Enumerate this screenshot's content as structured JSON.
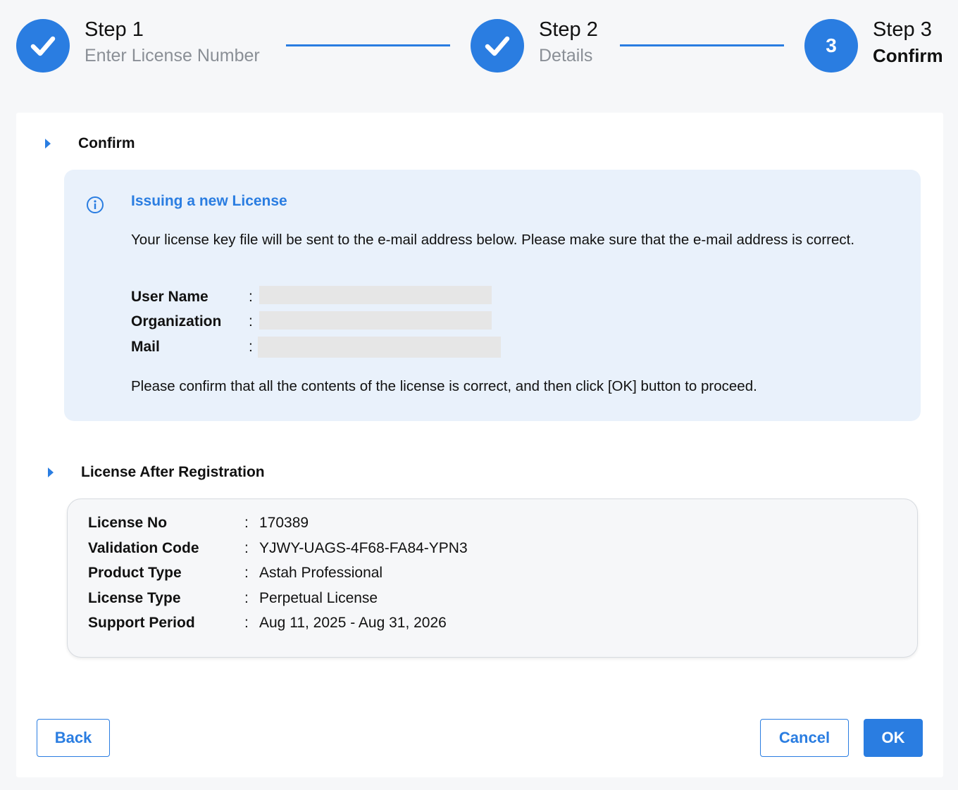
{
  "steps": [
    {
      "title": "Step 1",
      "subtitle": "Enter License Number",
      "status": "done",
      "icon": "check-icon"
    },
    {
      "title": "Step 2",
      "subtitle": "Details",
      "status": "done",
      "icon": "check-icon"
    },
    {
      "title": "Step 3",
      "subtitle": "Confirm",
      "status": "active",
      "number": "3"
    }
  ],
  "confirm_section": {
    "title": "Confirm",
    "info": {
      "icon": "info-icon",
      "title": "Issuing a new License",
      "text": "Your license key file will be sent to the e-mail address below. Please make sure that the e-mail address is correct.",
      "fields": [
        {
          "label": "User Name",
          "colon": ":"
        },
        {
          "label": "Organization",
          "colon": ":"
        },
        {
          "label": "Mail",
          "colon": ":"
        }
      ],
      "confirm_text": "Please confirm that all the contents of the license is correct, and then click [OK] button to proceed."
    }
  },
  "license_section": {
    "title": "License After Registration",
    "rows": [
      {
        "label": "License No",
        "colon": ":",
        "value": "170389"
      },
      {
        "label": "Validation Code",
        "colon": ":",
        "value": "YJWY-UAGS-4F68-FA84-YPN3"
      },
      {
        "label": "Product Type",
        "colon": ":",
        "value": "Astah Professional"
      },
      {
        "label": "License Type",
        "colon": ":",
        "value": "Perpetual License"
      },
      {
        "label": "Support Period",
        "colon": ":",
        "value": "Aug 11, 2025 - Aug 31, 2026"
      }
    ]
  },
  "buttons": {
    "back": "Back",
    "cancel": "Cancel",
    "ok": "OK"
  },
  "colors": {
    "accent": "#2a7de1",
    "info_bg": "#e9f1fb",
    "page_bg": "#f6f7f9"
  }
}
